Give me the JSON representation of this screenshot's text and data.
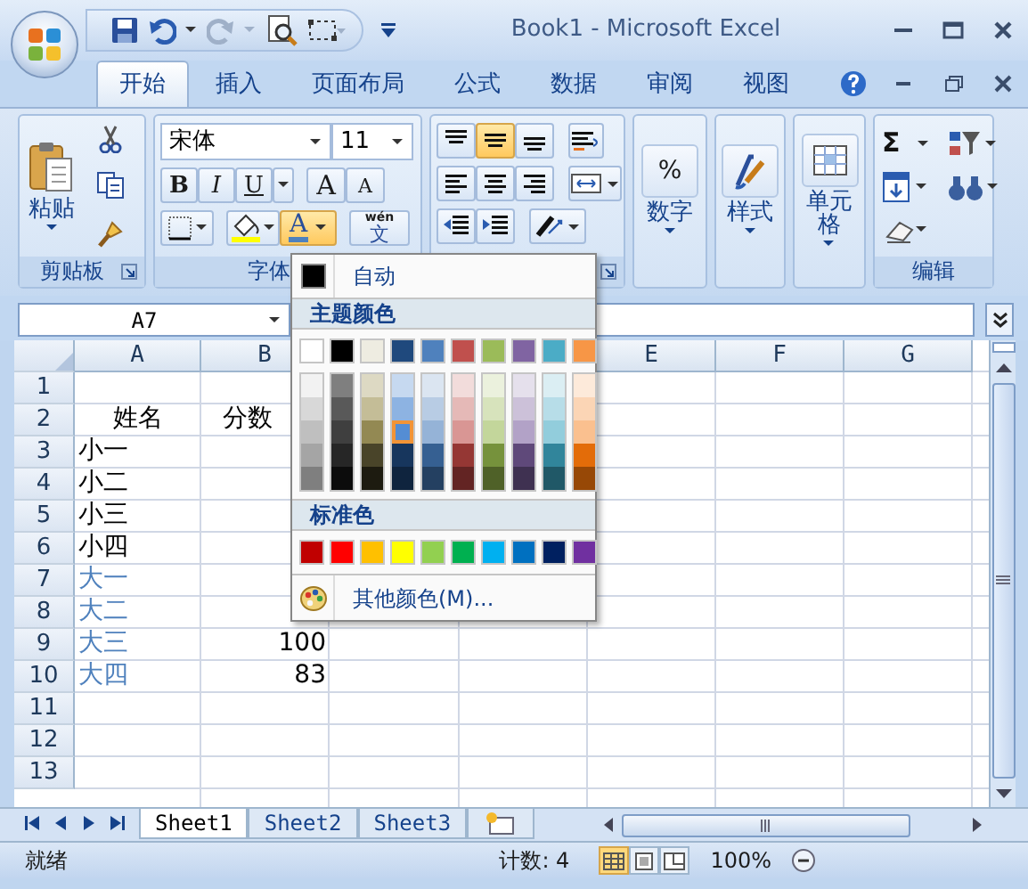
{
  "window": {
    "title": "Book1 - Microsoft Excel"
  },
  "ribbon_tabs": [
    {
      "label": "开始",
      "selected": true
    },
    {
      "label": "插入",
      "selected": false
    },
    {
      "label": "页面布局",
      "selected": false
    },
    {
      "label": "公式",
      "selected": false
    },
    {
      "label": "数据",
      "selected": false
    },
    {
      "label": "审阅",
      "selected": false
    },
    {
      "label": "视图",
      "selected": false
    }
  ],
  "clipboard": {
    "paste": "粘贴",
    "label": "剪贴板"
  },
  "font": {
    "name": "宋体",
    "size": "11",
    "styles": [
      "B",
      "I",
      "U"
    ],
    "grow": "A",
    "shrink": "A",
    "font_color": {
      "letter": "A",
      "expanded": true
    },
    "phonetic": {
      "pinyin": "wén",
      "char": "文"
    },
    "label": "字体"
  },
  "alignment": {
    "vertical": [
      {
        "selected": false
      },
      {
        "selected": true
      },
      {
        "selected": false
      }
    ]
  },
  "number": {
    "symbol": "%",
    "label": "数字"
  },
  "styles": {
    "label": "样式"
  },
  "cells": {
    "label": "单元格"
  },
  "editing": {
    "sum": "Σ",
    "label": "编辑"
  },
  "name_box": "A7",
  "columns": [
    {
      "label": "A"
    },
    {
      "label": "B"
    },
    {},
    {},
    {
      "label": "E"
    },
    {
      "label": "F"
    },
    {
      "label": "G"
    }
  ],
  "rows": [
    {
      "number": "1",
      "cells": []
    },
    {
      "number": "2",
      "cells": [
        {
          "text": "姓名",
          "kind": "center"
        },
        {
          "text": "分数",
          "kind": "center"
        }
      ]
    },
    {
      "number": "3",
      "cells": [
        {
          "text": "小一",
          "kind": "text"
        }
      ]
    },
    {
      "number": "4",
      "cells": [
        {
          "text": "小二",
          "kind": "text"
        }
      ]
    },
    {
      "number": "5",
      "cells": [
        {
          "text": "小三",
          "kind": "text"
        }
      ]
    },
    {
      "number": "6",
      "cells": [
        {
          "text": "小四",
          "kind": "text"
        }
      ]
    },
    {
      "number": "7",
      "cells": [
        {
          "text": "大一",
          "kind": "text",
          "color": "#4f81bd"
        }
      ]
    },
    {
      "number": "8",
      "cells": [
        {
          "text": "大二",
          "kind": "text",
          "color": "#4f81bd"
        }
      ]
    },
    {
      "number": "9",
      "cells": [
        {
          "text": "大三",
          "kind": "text",
          "color": "#4f81bd"
        },
        {
          "text": "100",
          "kind": "number"
        }
      ]
    },
    {
      "number": "10",
      "cells": [
        {
          "text": "大四",
          "kind": "text",
          "color": "#4f81bd"
        },
        {
          "text": "83",
          "kind": "number"
        }
      ]
    },
    {
      "number": "11",
      "cells": []
    },
    {
      "number": "12",
      "cells": []
    },
    {
      "number": "13",
      "cells": []
    }
  ],
  "color_menu": {
    "automatic": "自动",
    "theme_header": "主题颜色",
    "theme": [
      {
        "color": "#ffffff",
        "selected": false
      },
      {
        "color": "#000000",
        "selected": false
      },
      {
        "color": "#eeece1",
        "selected": false
      },
      {
        "color": "#1f497d",
        "selected": false
      },
      {
        "color": "#4f81bd",
        "selected": false
      },
      {
        "color": "#c0504d",
        "selected": false
      },
      {
        "color": "#9bbb59",
        "selected": false
      },
      {
        "color": "#8064a2",
        "selected": false
      },
      {
        "color": "#4bacc6",
        "selected": false
      },
      {
        "color": "#f79646",
        "selected": false
      }
    ],
    "shades": [
      {
        "tints": [
          {
            "color": "#f2f2f2",
            "selected": false
          },
          {
            "color": "#d8d8d8",
            "selected": false
          },
          {
            "color": "#bfbfbf",
            "selected": false
          },
          {
            "color": "#a5a5a5",
            "selected": false
          },
          {
            "color": "#7f7f7f",
            "selected": false
          }
        ]
      },
      {
        "tints": [
          {
            "color": "#7f7f7f",
            "selected": false
          },
          {
            "color": "#595959",
            "selected": false
          },
          {
            "color": "#3f3f3f",
            "selected": false
          },
          {
            "color": "#262626",
            "selected": false
          },
          {
            "color": "#0c0c0c",
            "selected": false
          }
        ]
      },
      {
        "tints": [
          {
            "color": "#ddd9c3",
            "selected": false
          },
          {
            "color": "#c4bd97",
            "selected": false
          },
          {
            "color": "#938953",
            "selected": false
          },
          {
            "color": "#494429",
            "selected": false
          },
          {
            "color": "#1d1b10",
            "selected": false
          }
        ]
      },
      {
        "tints": [
          {
            "color": "#c6d9f0",
            "selected": false
          },
          {
            "color": "#8db3e2",
            "selected": false
          },
          {
            "color": "#548dd4",
            "selected": true
          },
          {
            "color": "#17365d",
            "selected": false
          },
          {
            "color": "#0f243e",
            "selected": false
          }
        ]
      },
      {
        "tints": [
          {
            "color": "#dbe5f1",
            "selected": false
          },
          {
            "color": "#b8cce4",
            "selected": false
          },
          {
            "color": "#95b3d7",
            "selected": false
          },
          {
            "color": "#366092",
            "selected": false
          },
          {
            "color": "#244061",
            "selected": false
          }
        ]
      },
      {
        "tints": [
          {
            "color": "#f2dcdb",
            "selected": false
          },
          {
            "color": "#e5b9b7",
            "selected": false
          },
          {
            "color": "#d99694",
            "selected": false
          },
          {
            "color": "#953734",
            "selected": false
          },
          {
            "color": "#632423",
            "selected": false
          }
        ]
      },
      {
        "tints": [
          {
            "color": "#ebf1dd",
            "selected": false
          },
          {
            "color": "#d7e3bc",
            "selected": false
          },
          {
            "color": "#c3d69b",
            "selected": false
          },
          {
            "color": "#76923c",
            "selected": false
          },
          {
            "color": "#4f6128",
            "selected": false
          }
        ]
      },
      {
        "tints": [
          {
            "color": "#e5e0ec",
            "selected": false
          },
          {
            "color": "#ccc1d9",
            "selected": false
          },
          {
            "color": "#b2a2c7",
            "selected": false
          },
          {
            "color": "#5f497a",
            "selected": false
          },
          {
            "color": "#3f3151",
            "selected": false
          }
        ]
      },
      {
        "tints": [
          {
            "color": "#dbeef3",
            "selected": false
          },
          {
            "color": "#b7dde8",
            "selected": false
          },
          {
            "color": "#92cddc",
            "selected": false
          },
          {
            "color": "#31859b",
            "selected": false
          },
          {
            "color": "#205867",
            "selected": false
          }
        ]
      },
      {
        "tints": [
          {
            "color": "#fdeada",
            "selected": false
          },
          {
            "color": "#fbd5b5",
            "selected": false
          },
          {
            "color": "#fac08f",
            "selected": false
          },
          {
            "color": "#e36c09",
            "selected": false
          },
          {
            "color": "#974806",
            "selected": false
          }
        ]
      }
    ],
    "standard_header": "标准色",
    "standard": [
      {
        "color": "#c00000",
        "selected": false
      },
      {
        "color": "#ff0000",
        "selected": false
      },
      {
        "color": "#ffc000",
        "selected": false
      },
      {
        "color": "#ffff00",
        "selected": false
      },
      {
        "color": "#92d050",
        "selected": false
      },
      {
        "color": "#00b050",
        "selected": false
      },
      {
        "color": "#00b0f0",
        "selected": false
      },
      {
        "color": "#0070c0",
        "selected": false
      },
      {
        "color": "#002060",
        "selected": false
      },
      {
        "color": "#7030a0",
        "selected": false
      }
    ],
    "more": "其他颜色(M)..."
  },
  "sheets": [
    {
      "label": "Sheet1",
      "selected": true
    },
    {
      "label": "Sheet2",
      "selected": false
    },
    {
      "label": "Sheet3",
      "selected": false
    }
  ],
  "status": {
    "ready": "就绪",
    "count": "计数: 4",
    "views": [
      {
        "selected": true
      },
      {
        "selected": false
      },
      {
        "selected": false
      }
    ],
    "zoom": "100%"
  }
}
